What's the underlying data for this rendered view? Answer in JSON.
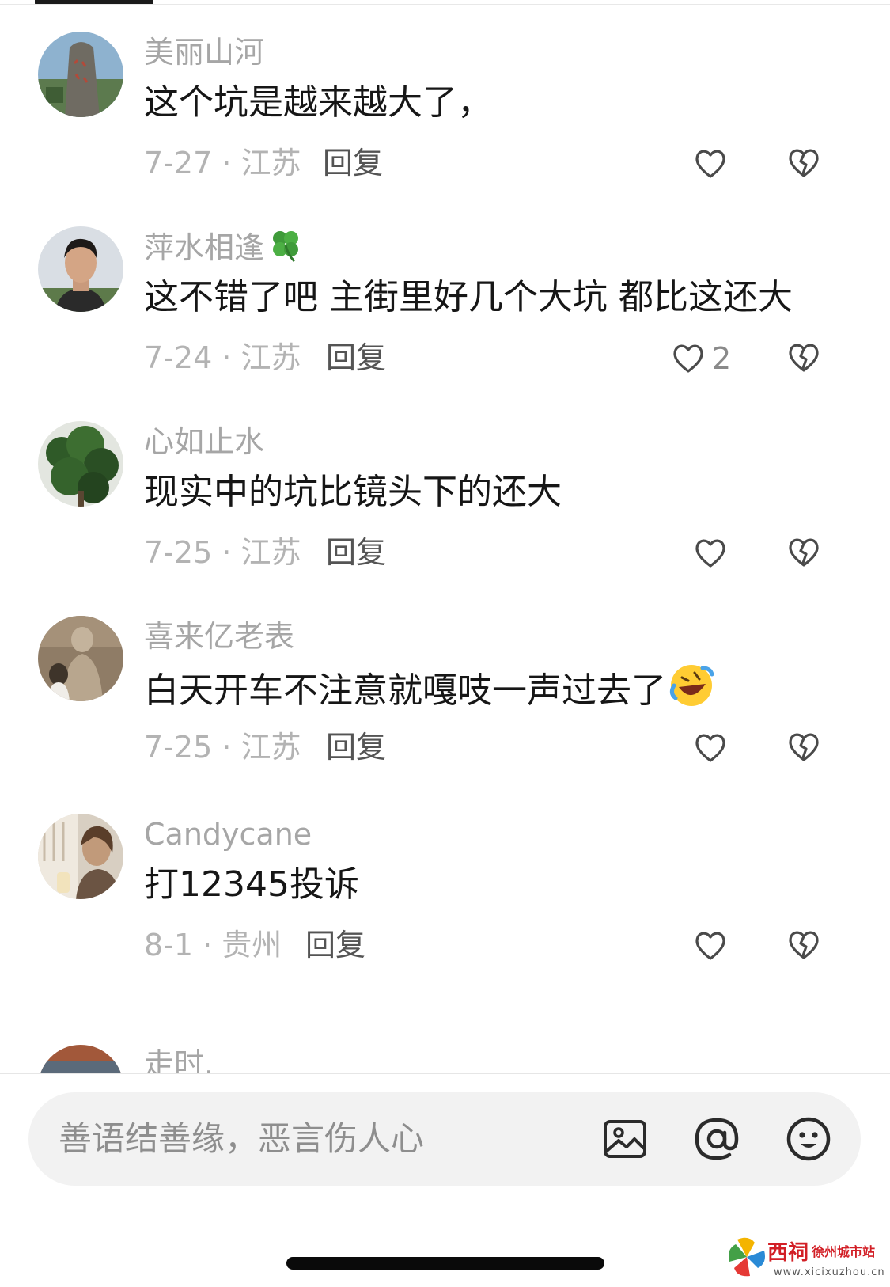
{
  "comments": [
    {
      "username": "美丽山河",
      "text": "这个坑是越来越大了，",
      "date_region": "7-27 · 江苏",
      "reply_label": "回复",
      "like_count": "",
      "avatar_theme": "stone-monument"
    },
    {
      "username": "萍水相逢",
      "username_emoji": "four-leaf-clover-icon",
      "text": "这不错了吧  主街里好几个大坑 都比这还大",
      "date_region": "7-24 · 江苏",
      "reply_label": "回复",
      "like_count": "2",
      "avatar_theme": "man-portrait"
    },
    {
      "username": "心如止水",
      "text": "现实中的坑比镜头下的还大",
      "date_region": "7-25 · 江苏",
      "reply_label": "回复",
      "like_count": "",
      "avatar_theme": "green-plant"
    },
    {
      "username": "喜来亿老表",
      "text": "白天开车不注意就嘎吱一声过去了",
      "text_emoji": "rolling-laughing-emoji-icon",
      "date_region": "7-25 · 江苏",
      "reply_label": "回复",
      "like_count": "",
      "avatar_theme": "buddha-statue"
    },
    {
      "username": "Candycane",
      "text": "打12345投诉",
      "date_region": "8-1 · 贵州",
      "reply_label": "回复",
      "like_count": "",
      "avatar_theme": "person-by-window"
    }
  ],
  "partial_comment": {
    "username": "走时."
  },
  "input": {
    "placeholder": "善语结善缘，恶言伤人心",
    "icons": [
      "image-icon",
      "at-mention-icon",
      "emoji-icon"
    ]
  },
  "watermark": {
    "name": "西祠",
    "subtitle": "徐州城市站",
    "url": "www.xicixuzhou.cn"
  },
  "colors": {
    "username": "#a6a6a6",
    "text": "#161616",
    "meta": "#b3b3b3",
    "reply": "#545454",
    "input_bg": "#f2f2f2",
    "watermark_red": "#d21f26"
  }
}
